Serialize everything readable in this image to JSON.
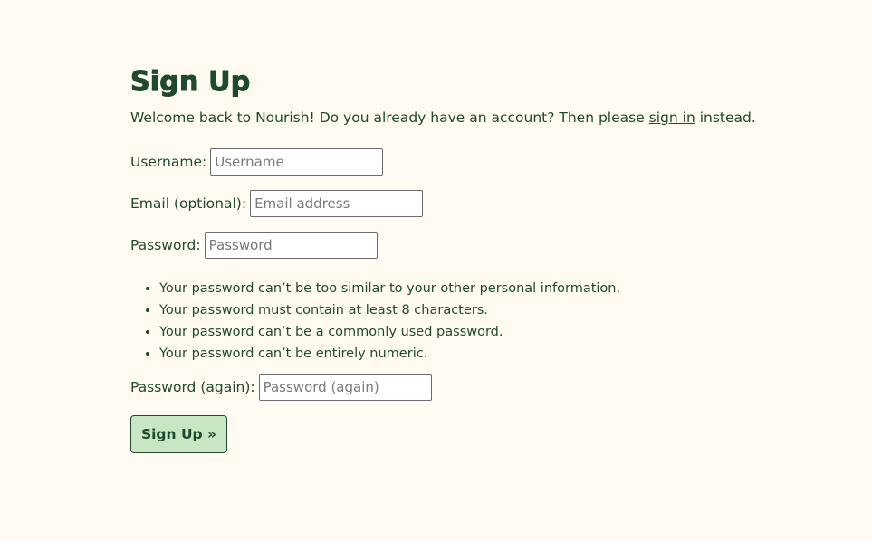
{
  "page": {
    "title": "Sign Up",
    "intro_before": "Welcome back to Nourish! Do you already have an account? Then please ",
    "intro_link": "sign in",
    "intro_after": " instead."
  },
  "form": {
    "username": {
      "label": "Username:",
      "placeholder": "Username",
      "value": ""
    },
    "email": {
      "label": "Email (optional):",
      "placeholder": "Email address",
      "value": ""
    },
    "password": {
      "label": "Password:",
      "placeholder": "Password",
      "value": ""
    },
    "password_again": {
      "label": "Password (again):",
      "placeholder": "Password (again)",
      "value": ""
    },
    "password_help": [
      "Your password can’t be too similar to your other personal information.",
      "Your password must contain at least 8 characters.",
      "Your password can’t be a commonly used password.",
      "Your password can’t be entirely numeric."
    ],
    "submit_label": "Sign Up »"
  },
  "colors": {
    "background": "#fffbf3",
    "text": "#1f4a2c",
    "button_bg": "#c8e5c4"
  }
}
